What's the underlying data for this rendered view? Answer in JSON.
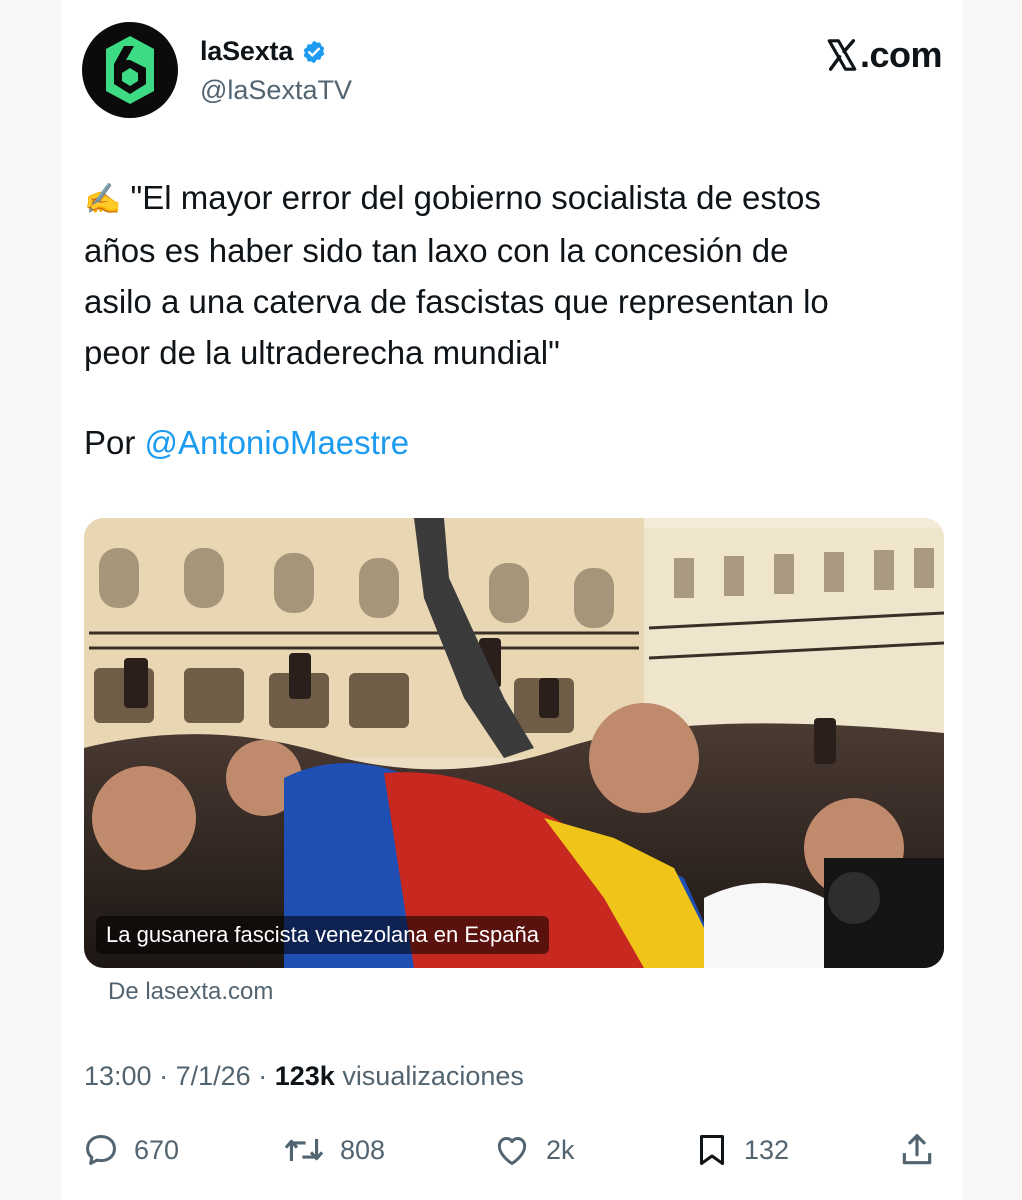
{
  "account": {
    "display_name": "laSexta",
    "handle": "@laSextaTV",
    "avatar_glyph": "6",
    "brand_color": "#3ddc84"
  },
  "site_label": ".com",
  "tweet": {
    "emoji": "✍️",
    "lines": [
      "\"El mayor error del gobierno socialista de estos",
      "años es haber sido tan laxo con la concesión de",
      "asilo a una caterva de fascistas que representan lo",
      "peor de la ultraderecha mundial\""
    ],
    "byline_prefix": "Por",
    "byline_mention": "@AntonioMaestre"
  },
  "media": {
    "caption": "La gusanera fascista venezolana en España",
    "source": "De lasexta.com"
  },
  "meta": {
    "time": "13:00",
    "date": "7/1/26",
    "views_count": "123k",
    "views_label": "visualizaciones"
  },
  "actions": {
    "replies": "670",
    "reposts": "808",
    "likes": "2k",
    "bookmarks": "132"
  },
  "colors": {
    "link": "#1d9bf0",
    "verified": "#1d9bf0",
    "muted": "#536471",
    "text": "#0f1419"
  },
  "icons": [
    "verified-badge-icon",
    "x-logo-icon",
    "reply-icon",
    "repost-icon",
    "like-icon",
    "bookmark-icon",
    "share-icon"
  ]
}
